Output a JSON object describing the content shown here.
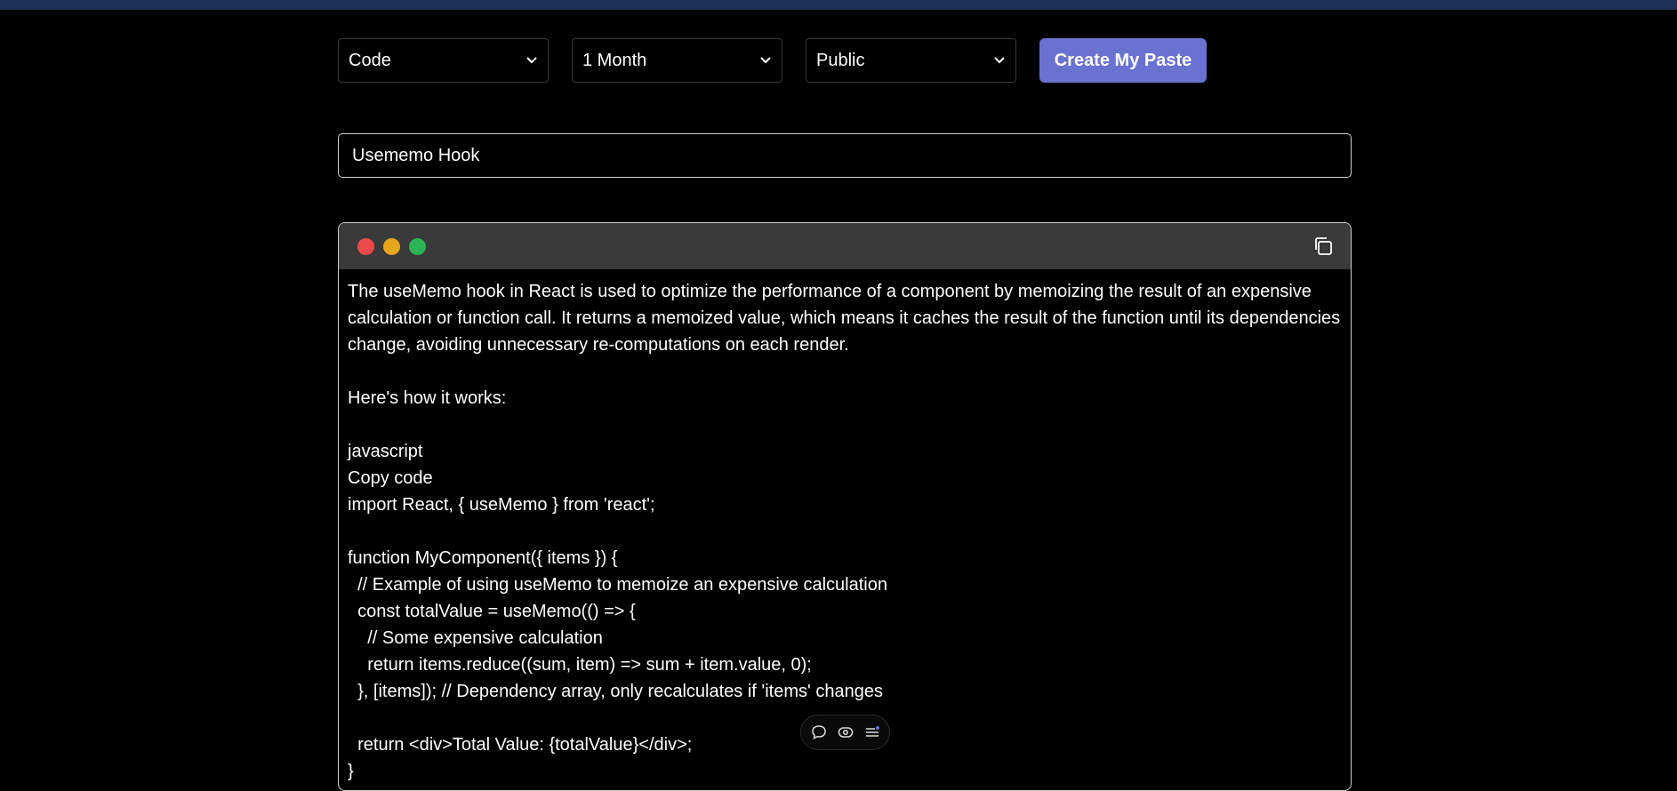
{
  "controls": {
    "type_select": "Code",
    "expiry_select": "1 Month",
    "visibility_select": "Public",
    "create_button": "Create My Paste"
  },
  "title_input": {
    "value": "Usememo Hook"
  },
  "editor": {
    "lines": [
      "The useMemo hook in React is used to optimize the performance of a component by memoizing the result of an expensive",
      "calculation or function call. It returns a memoized value, which means it caches the result of the function until its dependencies",
      "change, avoiding unnecessary re-computations on each render.",
      "",
      "Here's how it works:",
      "",
      "javascript",
      "Copy code",
      "import React, { useMemo } from 'react';",
      "",
      "function MyComponent({ items }) {",
      "  // Example of using useMemo to memoize an expensive calculation",
      "  const totalValue = useMemo(() => {",
      "    // Some expensive calculation",
      "    return items.reduce((sum, item) => sum + item.value, 0);",
      "  }, [items]); // Dependency array, only recalculates if 'items' changes",
      "",
      "  return <div>Total Value: {totalValue}</div>;",
      "}"
    ]
  },
  "icons": {
    "window_controls": [
      "close-dot",
      "minimize-dot",
      "maximize-dot"
    ],
    "copy": "copy-icon",
    "toolbar": [
      "comment-icon",
      "eye-icon",
      "menu-lines-icon"
    ]
  },
  "colors": {
    "topbar": "#1c3158",
    "accent_button": "#6a72cf",
    "editor_header": "#3a3a3a",
    "dot_red": "#ec4a4a",
    "dot_yellow": "#e7a71c",
    "dot_green": "#2bb553"
  }
}
